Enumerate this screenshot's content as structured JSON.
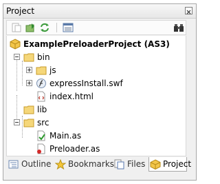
{
  "panel": {
    "title": "Project"
  },
  "toolbar": {
    "buttons": [
      "new-file-icon",
      "add-folder-icon",
      "refresh-icon",
      "properties-icon",
      "binoculars-icon"
    ]
  },
  "tree": {
    "root": "ExamplePreloaderProject (AS3)",
    "bin": "bin",
    "js": "js",
    "expressinstall": "expressInstall.swf",
    "index": "index.html",
    "lib": "lib",
    "src": "src",
    "main": "Main.as",
    "preloader": "Preloader.as"
  },
  "tabs": [
    {
      "label": "Outline",
      "icon": "outline-icon"
    },
    {
      "label": "Bookmarks",
      "icon": "star-icon"
    },
    {
      "label": "Files",
      "icon": "files-icon"
    },
    {
      "label": "Project",
      "icon": "project-icon",
      "active": true
    }
  ]
}
